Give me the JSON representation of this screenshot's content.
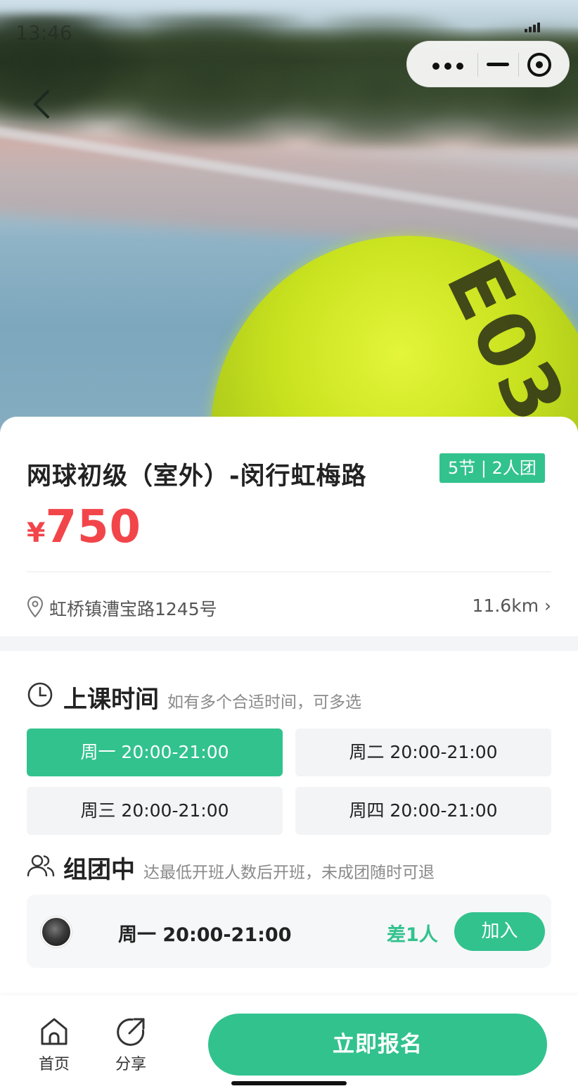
{
  "status_bar": {
    "time": "13:46"
  },
  "course": {
    "title": "网球初级（室外）-闵行虹梅路",
    "badge": "5节 | 2人团",
    "currency": "¥",
    "price": "750",
    "address": "虹桥镇漕宝路1245号",
    "distance": "11.6km ›"
  },
  "schedule": {
    "title": "上课时间",
    "hint": "如有多个合适时间，可多选",
    "slots": [
      {
        "label": "周一 20:00-21:00",
        "selected": true
      },
      {
        "label": "周二 20:00-21:00",
        "selected": false
      },
      {
        "label": "周三 20:00-21:00",
        "selected": false
      },
      {
        "label": "周四 20:00-21:00",
        "selected": false
      }
    ]
  },
  "group": {
    "title": "组团中",
    "hint": "达最低开班人数后开班，未成团随时可退",
    "entries": [
      {
        "time": "周一 20:00-21:00",
        "need": "差1人",
        "join_label": "加入"
      }
    ]
  },
  "bottom_nav": {
    "home_label": "首页",
    "share_label": "分享",
    "enroll_label": "立即报名"
  },
  "colors": {
    "accent": "#32c28e",
    "price": "#f2454a",
    "section_bg": "#f4f5f7"
  }
}
